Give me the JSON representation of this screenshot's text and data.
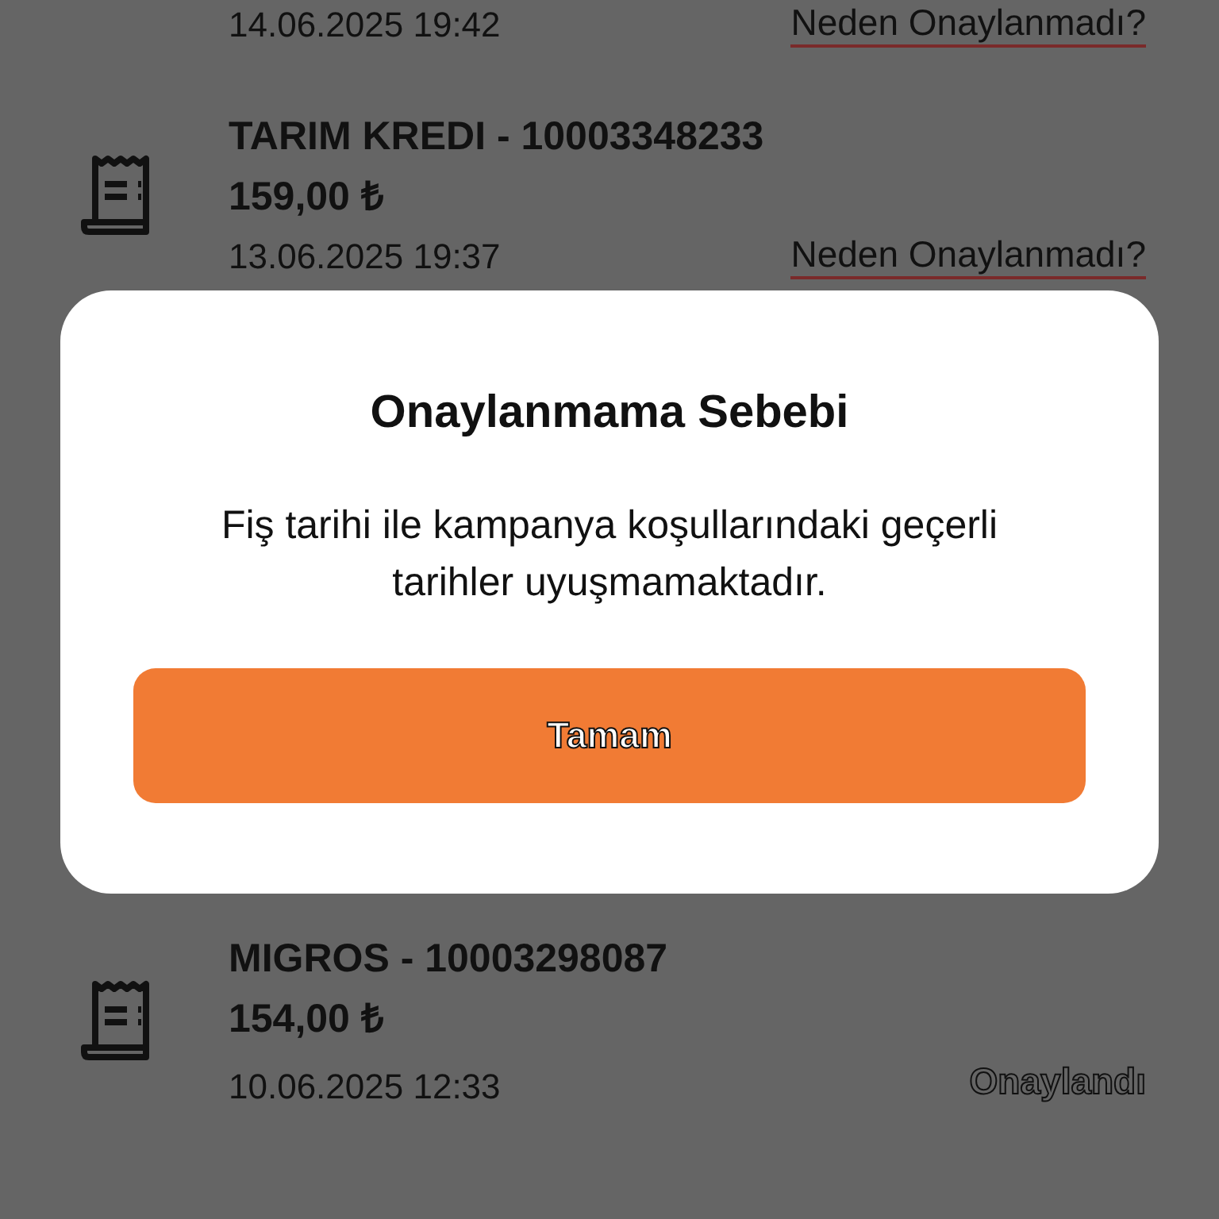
{
  "receipts": [
    {
      "date": "14.06.2025 19:42",
      "status": {
        "kind": "rejected",
        "text": "Neden Onaylanmadı?"
      }
    },
    {
      "title": "TARIM KREDI - 10003348233",
      "amount": "159,00 ₺",
      "date": "13.06.2025 19:37",
      "status": {
        "kind": "rejected",
        "text": "Neden Onaylanmadı?"
      }
    },
    {
      "title": "MIGROS - 10003298087",
      "amount": "154,00 ₺",
      "date": "10.06.2025 12:33",
      "status": {
        "kind": "approved",
        "text": "Onaylandı"
      }
    }
  ],
  "dialog": {
    "title": "Onaylanmama Sebebi",
    "message": "Fiş tarihi ile kampanya koşullarındaki geçerli tarihler uyuşmamaktadır.",
    "button": "Tamam"
  }
}
